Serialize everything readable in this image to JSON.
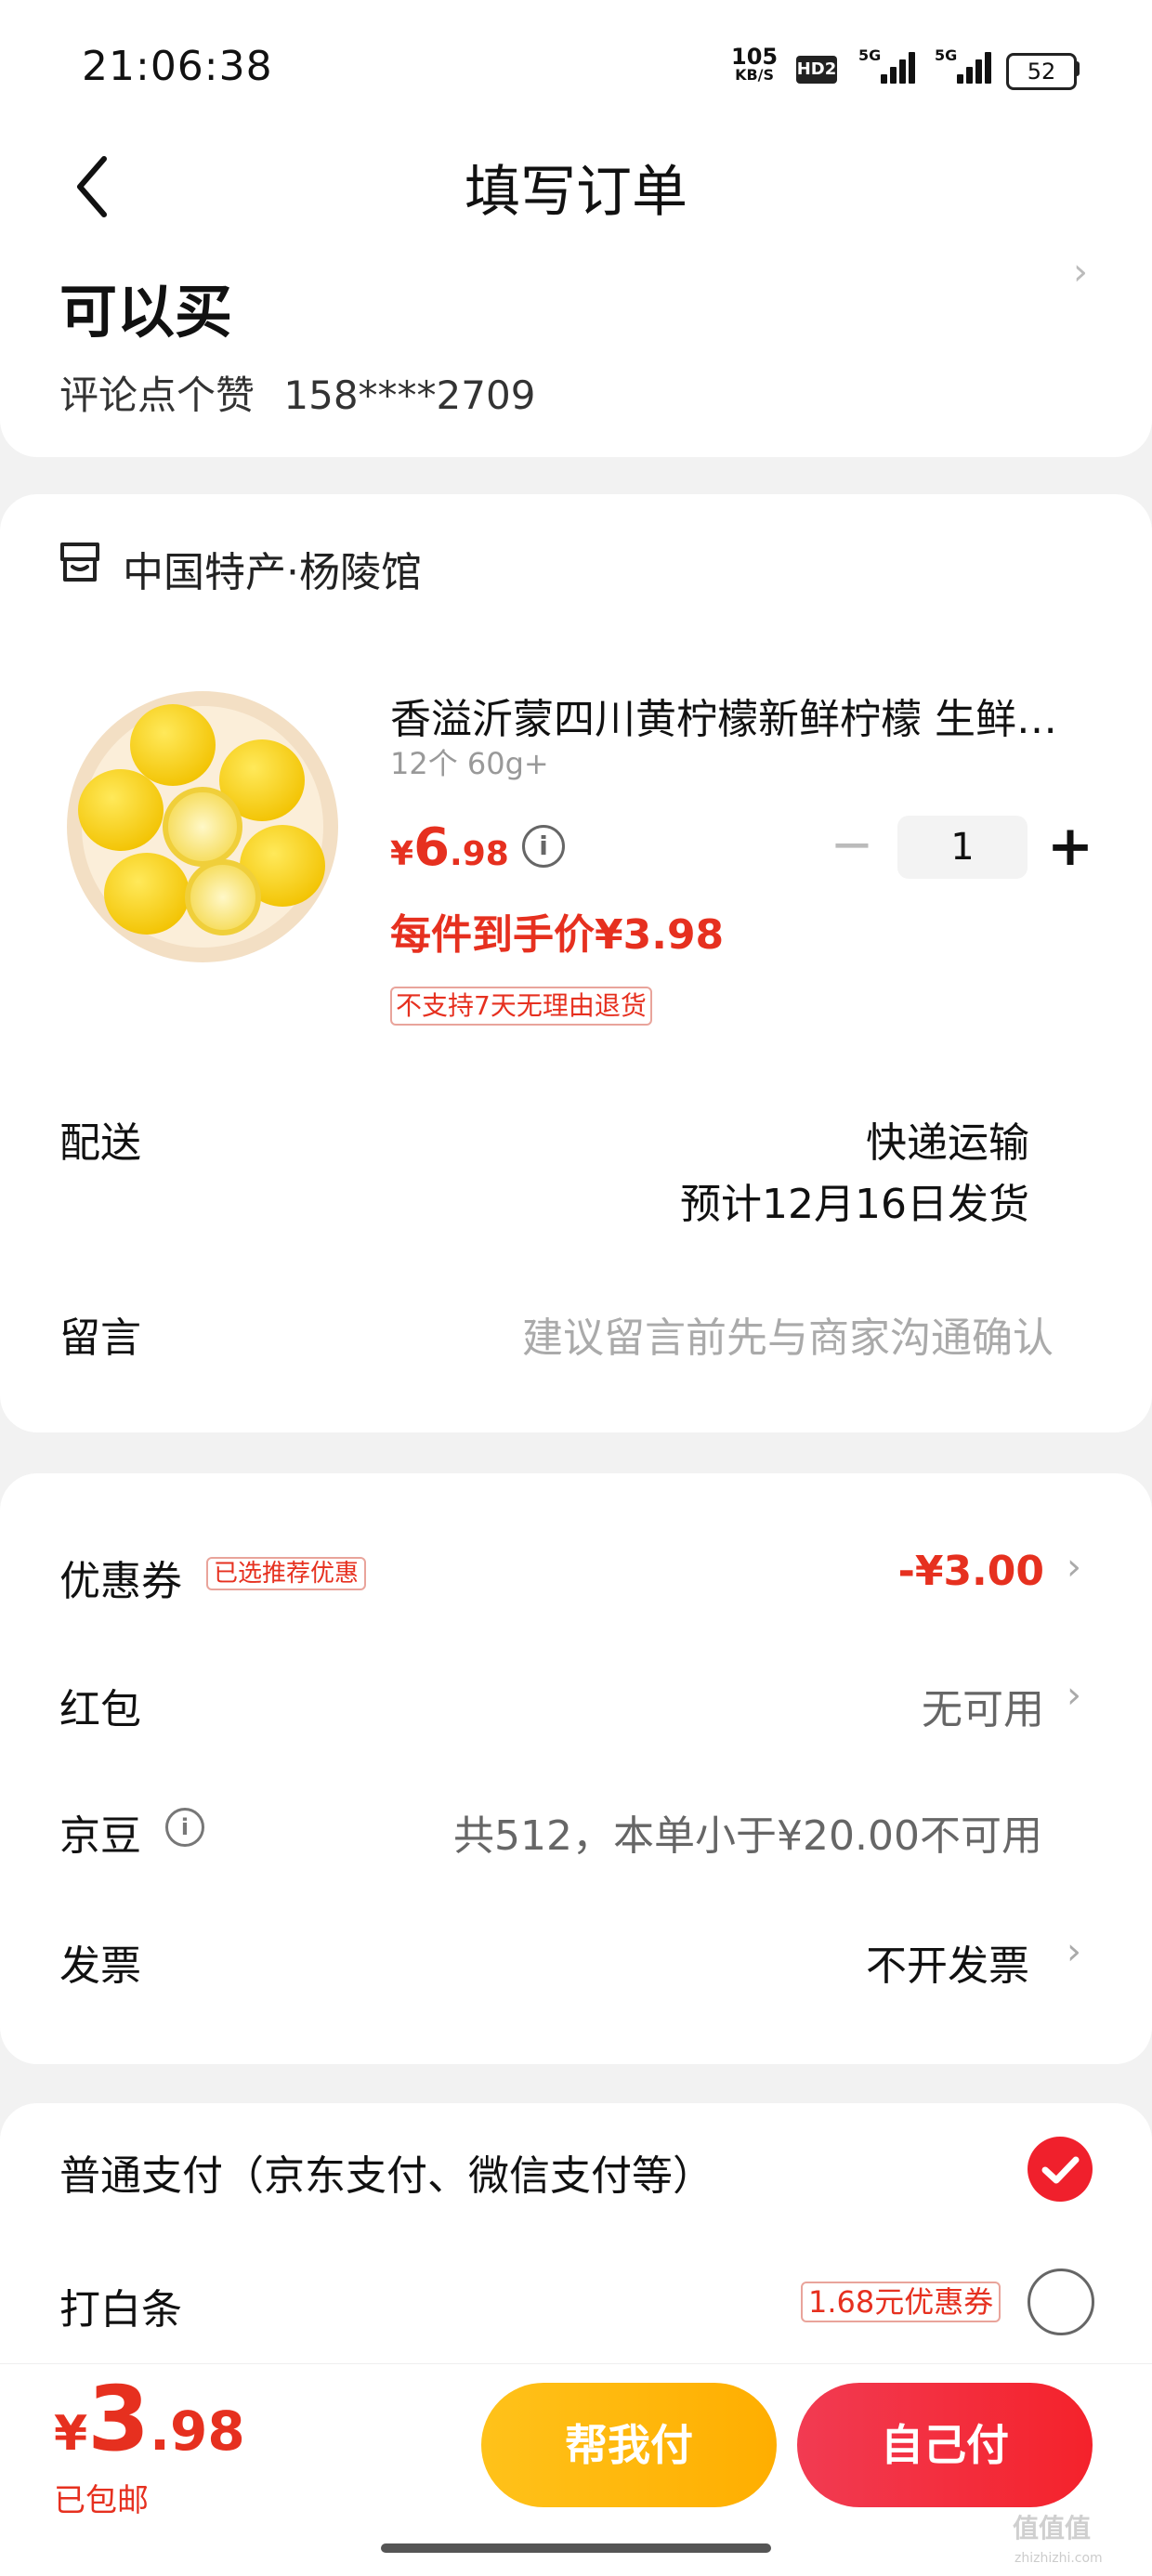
{
  "status_bar": {
    "time": "21:06:38",
    "net_speed_value": "105",
    "net_speed_unit": "KB/S",
    "hd_badge": "HD2",
    "signal1_label": "5G",
    "signal2_label": "5G",
    "battery": "52"
  },
  "header": {
    "title": "填写订单",
    "back_icon": "chevron-left-icon"
  },
  "address": {
    "name": "可以买",
    "contact": "评论点个赞",
    "phone": "158****2709"
  },
  "store": {
    "icon": "shop-icon",
    "name": "中国特产·杨陵馆",
    "product": {
      "title": "香溢沂蒙四川黄柠檬新鲜柠檬  生鲜水果",
      "spec": "12个 60g+",
      "price_symbol": "¥",
      "price_int": "6",
      "price_dec": ".98",
      "info_icon": "i",
      "quantity": "1",
      "minus": "−",
      "plus": "+",
      "arrival_price": "每件到手价¥3.98",
      "return_note": "不支持7天无理由退货"
    },
    "delivery": {
      "label": "配送",
      "method": "快递运输",
      "eta": "预计12月16日发货"
    },
    "message": {
      "label": "留言",
      "placeholder": "建议留言前先与商家沟通确认"
    }
  },
  "discounts": {
    "coupon": {
      "label": "优惠券",
      "tag": "已选推荐优惠",
      "value": "-¥3.00"
    },
    "red_packet": {
      "label": "红包",
      "value": "无可用"
    },
    "jingdou": {
      "label": "京豆",
      "info_icon": "i",
      "value": "共512，本单小于¥20.00不可用"
    },
    "invoice": {
      "label": "发票",
      "value": "不开发票"
    },
    "chevron": "›"
  },
  "payment": {
    "normal": {
      "label": "普通支付（京东支付、微信支付等）",
      "selected": true
    },
    "baitiao": {
      "label": "打白条",
      "tag": "1.68元优惠券",
      "selected": false
    }
  },
  "bottom": {
    "total_symbol": "¥",
    "total_int": "3",
    "total_dec": ".98",
    "shipping": "已包邮",
    "help_pay": "帮我付",
    "self_pay": "自己付"
  },
  "watermark": {
    "main": "值值值",
    "sub": "zhizhizhi.com"
  },
  "colors": {
    "accent_red": "#e6301f",
    "help_btn": "#ffb70d",
    "self_btn": "#f22a37"
  }
}
